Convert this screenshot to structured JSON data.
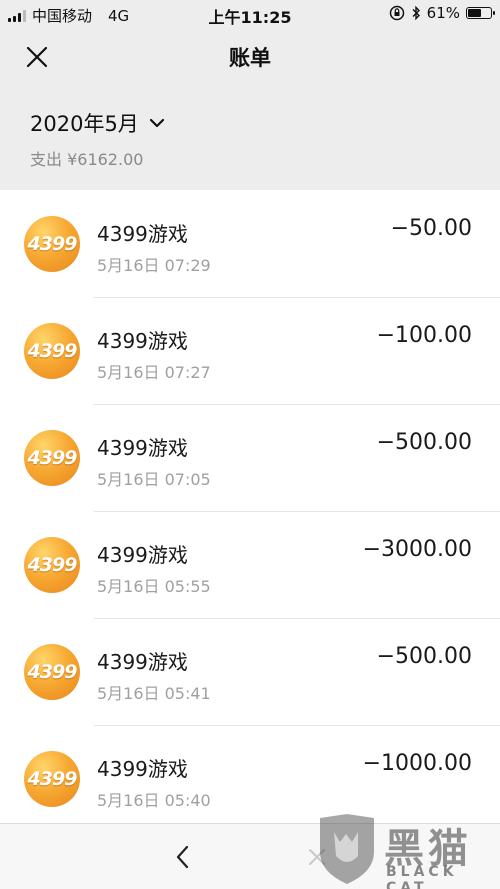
{
  "status_bar": {
    "carrier": "中国移动",
    "network": "4G",
    "time": "上午11:25",
    "battery": "61%",
    "battery_level": 0.61
  },
  "nav": {
    "title": "账单"
  },
  "summary": {
    "month": "2020年5月",
    "total": "支出 ¥6162.00"
  },
  "bills": [
    {
      "logo": "4399",
      "name": "4399游戏",
      "time": "5月16日 07:29",
      "amount": "−50.00"
    },
    {
      "logo": "4399",
      "name": "4399游戏",
      "time": "5月16日 07:27",
      "amount": "−100.00"
    },
    {
      "logo": "4399",
      "name": "4399游戏",
      "time": "5月16日 07:05",
      "amount": "−500.00"
    },
    {
      "logo": "4399",
      "name": "4399游戏",
      "time": "5月16日 05:55",
      "amount": "−3000.00"
    },
    {
      "logo": "4399",
      "name": "4399游戏",
      "time": "5月16日 05:41",
      "amount": "−500.00"
    },
    {
      "logo": "4399",
      "name": "4399游戏",
      "time": "5月16日 05:40",
      "amount": "−1000.00"
    }
  ],
  "watermark": {
    "text_cn": "黑猫",
    "text_en": "BLACK CAT"
  },
  "icons": {
    "close": "close-icon",
    "dropdown": "chevron-down-icon",
    "back": "chevron-left-icon",
    "forward": "close-icon"
  },
  "colors": {
    "header_bg": "#ededed",
    "logo_orange": "#f7a933",
    "text_primary": "#1a1a1a",
    "text_secondary": "#a0a0a0"
  }
}
